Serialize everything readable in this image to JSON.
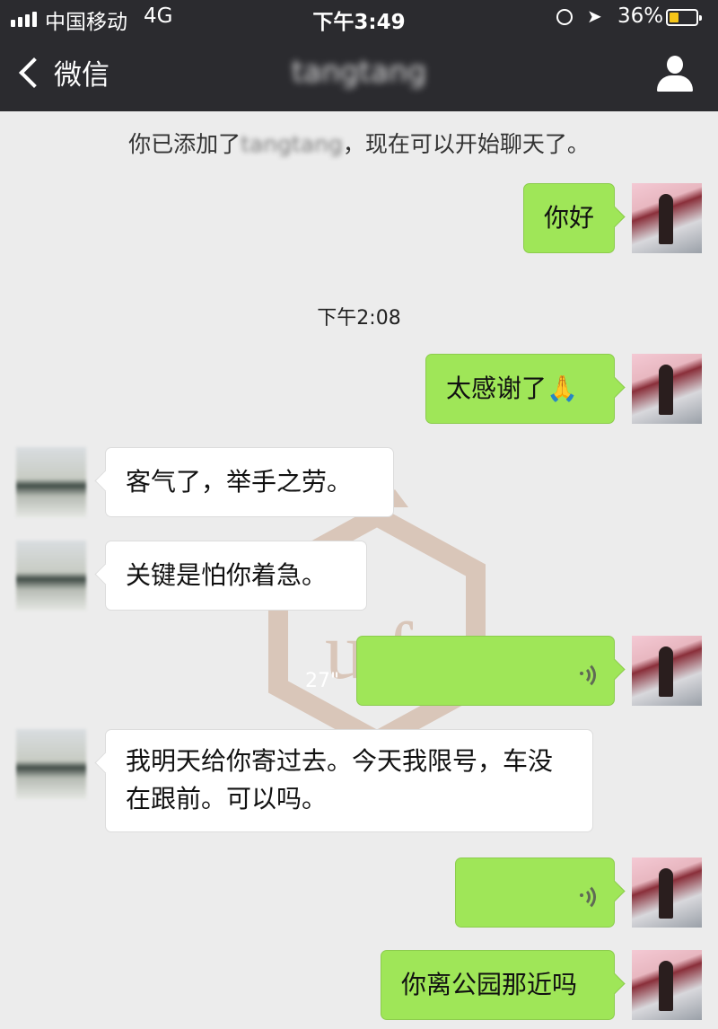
{
  "status_bar": {
    "carrier": "中国移动",
    "network": "4G",
    "time": "下午3:49",
    "location_icon": "➤",
    "battery": "36%",
    "battery_level": 0.36
  },
  "nav": {
    "back_label": "微信",
    "title": "tangtang",
    "profile_icon": "person-icon"
  },
  "system_message": {
    "before": "你已添加了",
    "name": "tangtang",
    "after": "，现在可以开始聊天了。"
  },
  "timestamp": "下午2:08",
  "messages": [
    {
      "from": "me",
      "text": "你好"
    },
    {
      "from": "me",
      "text": "太感谢了🙏"
    },
    {
      "from": "other",
      "text": "客气了，举手之劳。"
    },
    {
      "from": "other",
      "text": "关键是怕你着急。"
    },
    {
      "from": "me",
      "type": "voice",
      "duration": "27\""
    },
    {
      "from": "other",
      "text": "我明天给你寄过去。今天我限号，车没在跟前。可以吗。"
    },
    {
      "from": "me",
      "type": "voice",
      "duration": ""
    },
    {
      "from": "me",
      "text": "你离公园那近吗"
    }
  ],
  "watermark": {
    "text": "LY"
  }
}
